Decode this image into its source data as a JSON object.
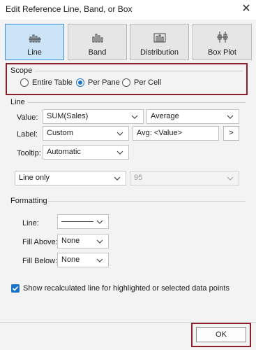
{
  "window": {
    "title": "Edit Reference Line, Band, or Box",
    "close_label": "✕"
  },
  "types": [
    {
      "label": "Line",
      "selected": true,
      "icon": "line-icon"
    },
    {
      "label": "Band",
      "selected": false,
      "icon": "band-icon"
    },
    {
      "label": "Distribution",
      "selected": false,
      "icon": "distribution-icon"
    },
    {
      "label": "Box Plot",
      "selected": false,
      "icon": "box-plot-icon"
    }
  ],
  "scope": {
    "label": "Scope",
    "options": [
      {
        "label": "Entire Table",
        "selected": false
      },
      {
        "label": "Per Pane",
        "selected": true
      },
      {
        "label": "Per Cell",
        "selected": false
      }
    ]
  },
  "line": {
    "label": "Line",
    "value_label": "Value:",
    "value_field": "SUM(Sales)",
    "aggregation": "Average",
    "label_label": "Label:",
    "label_mode": "Custom",
    "label_text": "Avg: <Value>",
    "insert_button": ">",
    "tooltip_label": "Tooltip:",
    "tooltip_mode": "Automatic",
    "display": "Line only",
    "percent": "95"
  },
  "formatting": {
    "label": "Formatting",
    "line_label": "Line:",
    "fill_above_label": "Fill Above:",
    "fill_above": "None",
    "fill_below_label": "Fill Below:",
    "fill_below": "None"
  },
  "recalc": {
    "label": "Show recalculated line for highlighted or selected data points",
    "checked": true
  },
  "ok_label": "OK",
  "colors": {
    "accent": "#1a73c8",
    "highlight_border": "#8b1f2b",
    "selected_bg": "#cce4f7"
  }
}
